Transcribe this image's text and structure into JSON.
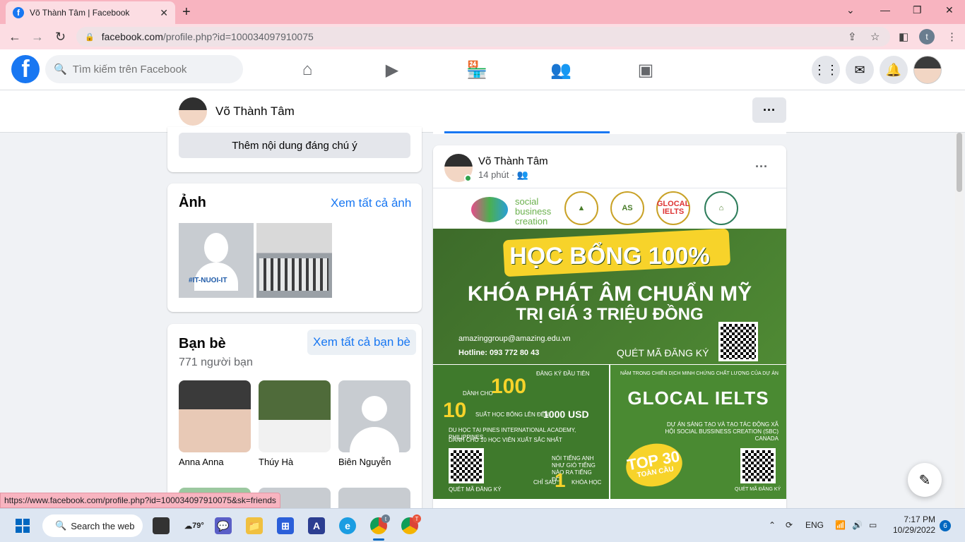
{
  "browser": {
    "tab_title": "Võ Thành Tâm | Facebook",
    "tab_favicon": "f",
    "new_tab": "+",
    "url_host": "facebook.com",
    "url_path": "/profile.php?id=100034097910075",
    "profile_initial": "t",
    "status_url": "https://www.facebook.com/profile.php?id=100034097910075&sk=friends"
  },
  "header": {
    "logo": "f",
    "search_placeholder": "Tìm kiếm trên Facebook"
  },
  "profile_bar": {
    "name": "Võ Thành Tâm",
    "more": "···"
  },
  "left": {
    "featured_button": "Thêm nội dung đáng chú ý",
    "photos": {
      "title": "Ảnh",
      "see_all": "Xem tất cả ảnh",
      "photo1_tag": "#IT-NUOI-IT"
    },
    "friends": {
      "title": "Bạn bè",
      "see_all": "Xem tất cả bạn bè",
      "count": "771 người bạn",
      "items": [
        {
          "name": "Anna Anna"
        },
        {
          "name": "Thúy Hà"
        },
        {
          "name": "Biên Nguyễn"
        }
      ]
    }
  },
  "post": {
    "author": "Võ Thành Tâm",
    "time": "14 phút · 👥",
    "more": "···",
    "banner": {
      "sbc_logo": "social business creation",
      "badge_glocal": "GLOCAL IELTS",
      "title": "HỌC BỔNG 100%",
      "line1": "KHÓA PHÁT ÂM CHUẨN MỸ",
      "line2": "TRỊ GIÁ 3 TRIỆU ĐỒNG",
      "email": "amazinggroup@amazing.edu.vn",
      "hotline": "Hotline: 093 772 80 43",
      "scan": "QUÉT MÃ ĐĂNG KÝ"
    },
    "left_panel": {
      "num100": "100",
      "text1": "DÀNH CHO",
      "text2": "ĐĂNG KÝ ĐẦU TIÊN",
      "num10": "10",
      "text3": "SUẤT HỌC BỔNG LÊN ĐẾN",
      "usd": "1000 USD",
      "text4": "DU HỌC TẠI PINES INTERNATIONAL ACADEMY, PHILIPPINES",
      "text5": "DÀNH CHO 10 HỌC VIÊN XUẤT SẮC NHẤT",
      "text6": "NÓI TIẾNG ANH NHƯ GIÓ TIẾNG NÀO RA TIẾNG ĐÓ",
      "text7": "CHỈ SAU",
      "num1": "1",
      "text8": "KHÓA HỌC",
      "scan": "QUÉT MÃ ĐĂNG KÝ"
    },
    "right_panel": {
      "title": "GLOCAL IELTS",
      "text1": "NẰM TRONG CHIẾN DỊCH MINH CHỨNG CHẤT LƯỢNG CỦA DỰ ÁN",
      "text2": "DỰ ÁN SÁNG TẠO VÀ TẠO TÁC ĐỘNG XÃ HỘI SOCIAL BUSSINESS CREATION (SBC) CANADA",
      "top30": "TOP 30",
      "top30_sub": "TOÀN CẦU",
      "scan": "QUÉT MÃ ĐĂNG KÝ"
    }
  },
  "taskbar": {
    "search": "Search the web",
    "weather": "79°",
    "chrome_badge1": "t",
    "chrome_badge2": "T",
    "lang": "ENG",
    "time": "7:17 PM",
    "date": "10/29/2022",
    "notifications": "6"
  },
  "colors": {
    "facebook_blue": "#1877f2",
    "tabbar_pink": "#f8b4c0",
    "banner_green": "#4f8a34",
    "banner_yellow": "#f7d32a"
  }
}
